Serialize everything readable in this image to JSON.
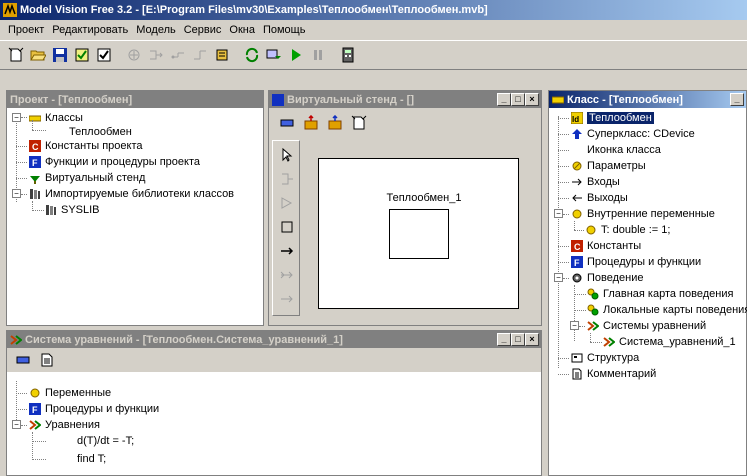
{
  "app": {
    "title": "Model Vision Free 3.2 - [E:\\Program Files\\mv30\\Examples\\Теплообмен\\Теплообмен.mvb]"
  },
  "menu": [
    "Проект",
    "Редактировать",
    "Модель",
    "Сервис",
    "Окна",
    "Помощь"
  ],
  "project_panel": {
    "title": "Проект - [Теплообмен]",
    "nodes": [
      {
        "label": "Классы"
      },
      {
        "label": "Теплообмен"
      },
      {
        "label": "Константы проекта"
      },
      {
        "label": "Функции и процедуры проекта"
      },
      {
        "label": "Виртуальный стенд"
      },
      {
        "label": "Импортируемые библиотеки классов"
      },
      {
        "label": "SYSLIB"
      }
    ]
  },
  "stand_panel": {
    "title": "Виртуальный стенд - []",
    "block_label": "Теплообмен_1"
  },
  "equations_panel": {
    "title": "Система уравнений - [Теплообмен.Система_уравнений_1]",
    "nodes": [
      {
        "label": "Переменные"
      },
      {
        "label": "Процедуры и функции"
      },
      {
        "label": "Уравнения"
      },
      {
        "label": "d(T)/dt = -T;"
      },
      {
        "label": "find T;"
      }
    ]
  },
  "class_panel": {
    "title": "Класс - [Теплообмен]",
    "nodes": [
      {
        "label": "Теплообмен"
      },
      {
        "label": "Суперкласс: CDevice"
      },
      {
        "label": "Иконка класса"
      },
      {
        "label": "Параметры"
      },
      {
        "label": "Входы"
      },
      {
        "label": "Выходы"
      },
      {
        "label": "Внутренние переменные"
      },
      {
        "label": "T: double := 1;"
      },
      {
        "label": "Константы"
      },
      {
        "label": "Процедуры и функции"
      },
      {
        "label": "Поведение"
      },
      {
        "label": "Главная карта поведения"
      },
      {
        "label": "Локальные карты поведения"
      },
      {
        "label": "Системы уравнений"
      },
      {
        "label": "Система_уравнений_1"
      },
      {
        "label": "Структура"
      },
      {
        "label": "Комментарий"
      }
    ]
  },
  "window_buttons": {
    "minimize": "_",
    "maximize": "□",
    "close": "×"
  },
  "colors": {
    "active_title": "#0a246a",
    "inactive_title": "#808080",
    "face": "#d4d0c8"
  }
}
